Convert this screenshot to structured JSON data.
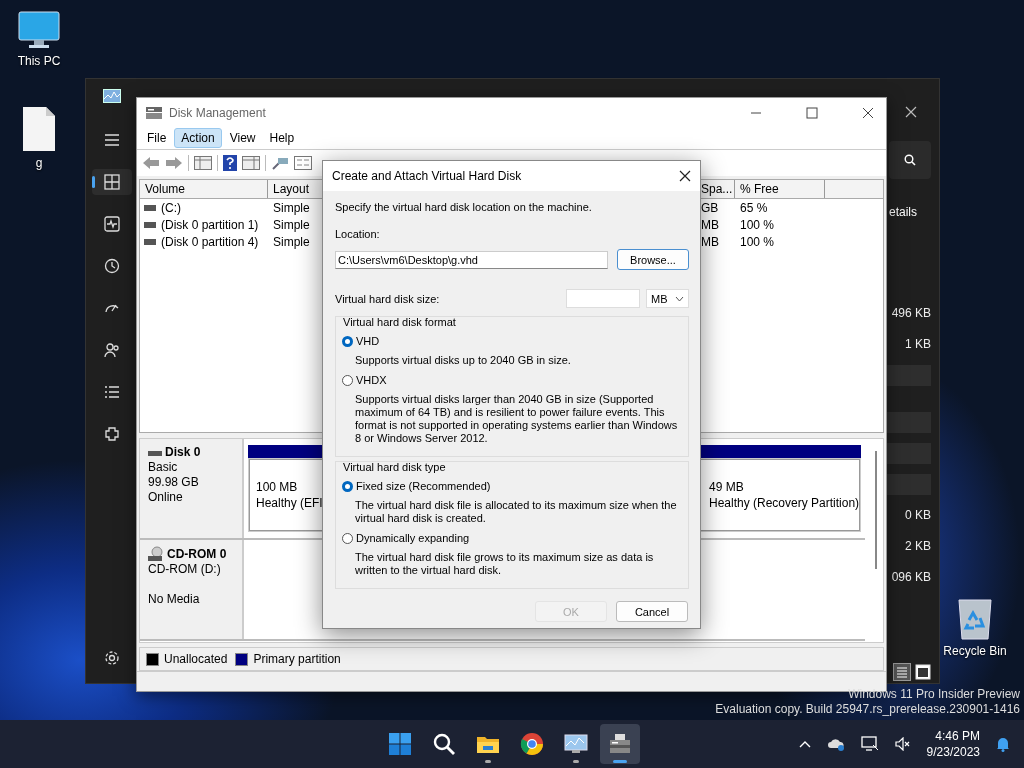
{
  "desktop_icons": [
    {
      "kind": "monitor",
      "label": "This PC"
    },
    {
      "kind": "file",
      "label": "g"
    },
    {
      "kind": "recycle-bin",
      "label": "Recycle Bin"
    }
  ],
  "task_manager": {
    "nav": [
      {
        "kind": "menu",
        "selected": false
      },
      {
        "kind": "processes",
        "selected": true
      },
      {
        "kind": "performance",
        "selected": false
      },
      {
        "kind": "history",
        "selected": false
      },
      {
        "kind": "startup",
        "selected": false
      },
      {
        "kind": "users",
        "selected": false
      },
      {
        "kind": "details",
        "selected": false
      },
      {
        "kind": "services",
        "selected": false
      },
      {
        "kind": "settings",
        "selected": false
      }
    ],
    "tab_fragment": "etails",
    "rows": [
      {
        "kind": "value",
        "value": "496 KB"
      },
      {
        "kind": "value",
        "value": "1 KB"
      },
      {
        "kind": "blank"
      },
      {
        "kind": "blank"
      },
      {
        "kind": "blank"
      },
      {
        "kind": "blank"
      },
      {
        "kind": "value",
        "value": "0 KB"
      },
      {
        "kind": "value",
        "value": "2 KB"
      },
      {
        "kind": "value",
        "value": "096 KB"
      }
    ]
  },
  "disk_management": {
    "title": "Disk Management",
    "menu": [
      {
        "label": "File",
        "selected": false
      },
      {
        "label": "Action",
        "selected": true
      },
      {
        "label": "View",
        "selected": false
      },
      {
        "label": "Help",
        "selected": false
      }
    ],
    "columns": [
      "Volume",
      "Layout"
    ],
    "right_columns": [
      "Spa...",
      "% Free"
    ],
    "volumes": [
      {
        "volume": "(C:)",
        "layout": "Simple",
        "free_space": "GB",
        "percent_free": "65 %"
      },
      {
        "volume": "(Disk 0 partition 1)",
        "layout": "Simple",
        "free_space": "MB",
        "percent_free": "100 %"
      },
      {
        "volume": "(Disk 0 partition 4)",
        "layout": "Simple",
        "free_space": "MB",
        "percent_free": "100 %"
      }
    ],
    "disks": [
      {
        "kind": "hdd",
        "name": "Disk 0",
        "type": "Basic",
        "size": "99.98 GB",
        "status": "Online",
        "partitions": [
          {
            "size": "100 MB",
            "status": "Healthy (EFI"
          },
          {
            "size": "49 MB",
            "status": "Healthy (Recovery Partition)"
          }
        ]
      },
      {
        "kind": "cdrom",
        "name": "CD-ROM 0",
        "type": "CD-ROM (D:)",
        "status": "No Media"
      }
    ],
    "legend": [
      {
        "label": "Unallocated",
        "color": "#000000"
      },
      {
        "label": "Primary partition",
        "color": "#000080"
      }
    ]
  },
  "dialog": {
    "title": "Create and Attach Virtual Hard Disk",
    "instruction": "Specify the virtual hard disk location on the machine.",
    "location_label": "Location:",
    "location_value": "C:\\Users\\vm6\\Desktop\\g.vhd",
    "browse_button": "Browse...",
    "size_label": "Virtual hard disk size:",
    "size_unit": "MB",
    "groups": [
      {
        "legend": "Virtual hard disk format",
        "options": [
          {
            "label": "VHD",
            "selected": true,
            "description": "Supports virtual disks up to 2040 GB in size."
          },
          {
            "label": "VHDX",
            "selected": false,
            "description": "Supports virtual disks larger than 2040 GB in size (Supported maximum of 64 TB) and is resilient to power failure events. This format is not supported in operating systems earlier than Windows 8 or Windows Server 2012."
          }
        ]
      },
      {
        "legend": "Virtual hard disk type",
        "options": [
          {
            "label": "Fixed size (Recommended)",
            "selected": true,
            "description": "The virtual hard disk file is allocated to its maximum size when the virtual hard disk is created."
          },
          {
            "label": "Dynamically expanding",
            "selected": false,
            "description": "The virtual hard disk file grows to its maximum size as data is written to the virtual hard disk."
          }
        ]
      }
    ],
    "ok_button": {
      "label": "OK",
      "disabled": true
    },
    "cancel_button": "Cancel"
  },
  "os_watermark": [
    "Windows 11 Pro Insider Preview",
    "Evaluation copy. Build 25947.rs_prerelease.230901-1416"
  ],
  "taskbar": {
    "apps": [
      {
        "kind": "start",
        "running": false,
        "selected": false
      },
      {
        "kind": "search",
        "running": false,
        "selected": false
      },
      {
        "kind": "folder",
        "running": true,
        "selected": false
      },
      {
        "kind": "browser",
        "running": false,
        "selected": false
      },
      {
        "kind": "monitor",
        "running": true,
        "selected": false
      },
      {
        "kind": "disk-tool",
        "running": true,
        "selected": true
      }
    ],
    "time": "4:46 PM",
    "date": "9/23/2023"
  }
}
